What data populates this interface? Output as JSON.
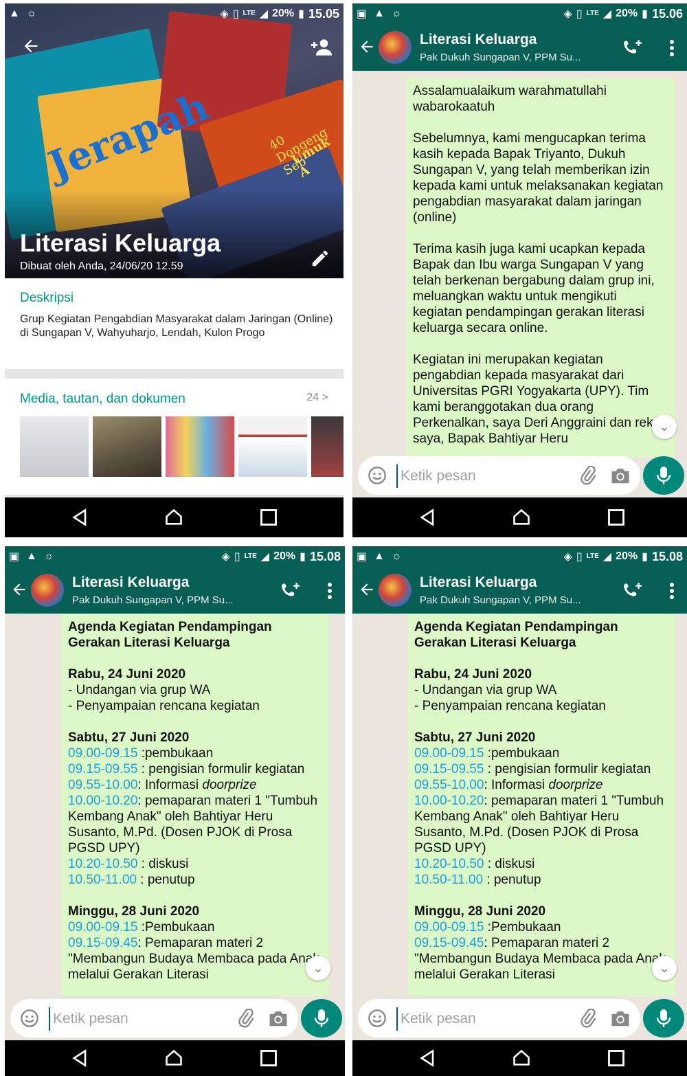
{
  "status_bars": [
    {
      "battery": "20%",
      "time": "15.05",
      "network": "LTE"
    },
    {
      "battery": "20%",
      "time": "15.06",
      "network": "LTE"
    },
    {
      "battery": "20%",
      "time": "15.08",
      "network": "LTE"
    },
    {
      "battery": "20%",
      "time": "15.08",
      "network": "LTE"
    }
  ],
  "group_info": {
    "cover_title": "Literasi Keluarga",
    "created_by": "Dibuat oleh Anda, 24/06/20 12.59",
    "description_title": "Deskripsi",
    "description": "Grup Kegiatan Pengabdian Masyarakat dalam Jaringan (Online) di Sungapan V, Wahyuharjo, Lendah, Kulon Progo",
    "media_title": "Media, tautan, dan dokumen",
    "media_count": "24 >",
    "cover_book_texts": [
      "Jerapah",
      "40 Dongeng Seb",
      "Umuk A"
    ]
  },
  "chat": {
    "title": "Literasi Keluarga",
    "subtitle": "Pak Dukuh Sungapan V, PPM Su...",
    "input_placeholder": "Ketik pesan"
  },
  "message_welcome": {
    "p1": "Assalamualaikum warahmatullahi wabarokaatuh",
    "p2": "Sebelumnya, kami mengucapkan terima kasih kepada Bapak Triyanto, Dukuh Sungapan V, yang telah memberikan izin kepada kami untuk melaksanakan kegiatan pengabdian masyarakat dalam jaringan (online)",
    "p3": "Terima kasih juga kami ucapkan kepada Bapak dan Ibu warga Sungapan V yang telah berkenan bergabung dalam grup ini, meluangkan waktu untuk mengikuti kegiatan pendampingan gerakan literasi keluarga secara online.",
    "p4": "Kegiatan ini merupakan kegiatan pengabdian kepada masyarakat dari Universitas PGRI Yogyakarta (UPY). Tim kami beranggotakan dua orang Perkenalkan, saya Deri Anggraini dan rekan saya, Bapak Bahtiyar Heru"
  },
  "agenda": {
    "title": "Agenda Kegiatan Pendampingan Gerakan Literasi Keluarga",
    "day1": "Rabu, 24 Juni 2020",
    "day1_items": [
      "- Undangan via grup WA",
      "- Penyampaian rencana kegiatan"
    ],
    "day2": "Sabtu, 27 Juni 2020",
    "t1": "09.00-09.15",
    "a1": " :pembukaan",
    "t2": "09.15-09.55",
    "a2": " : pengisian formulir kegiatan",
    "t3": "09.55-10.00",
    "a3": ": Informasi ",
    "a3_italic": "doorprize",
    "t4": "10.00-10.20",
    "a4": ": pemaparan materi 1 \"Tumbuh Kembang Anak\" oleh Bahtiyar Heru Susanto, M.Pd. (Dosen PJOK di Prosa PGSD UPY)",
    "t5": "10.20-10.50",
    "a5": " : diskusi",
    "t6": "10.50-11.00",
    "a6": " : penutup",
    "day3": "Minggu, 28 Juni 2020",
    "t7": "09.00-09.15",
    "a7": " :Pembukaan",
    "t8": "09.15-09.45",
    "a8": ": Pemaparan materi 2 \"Membangun Budaya Membaca pada Anak melalui Gerakan Literasi"
  },
  "colors": {
    "header": "#075e54",
    "bubble": "#dcf8c6",
    "accent": "#009688",
    "time_link": "#1ba1e2",
    "mic": "#00897b"
  },
  "icons": [
    "back-arrow-icon",
    "add-person-icon",
    "edit-pencil-icon",
    "add-call-icon",
    "more-vert-icon",
    "emoji-icon",
    "attach-icon",
    "camera-icon",
    "mic-icon",
    "chevron-down-icon",
    "nav-back-icon",
    "nav-home-icon",
    "nav-recents-icon"
  ]
}
